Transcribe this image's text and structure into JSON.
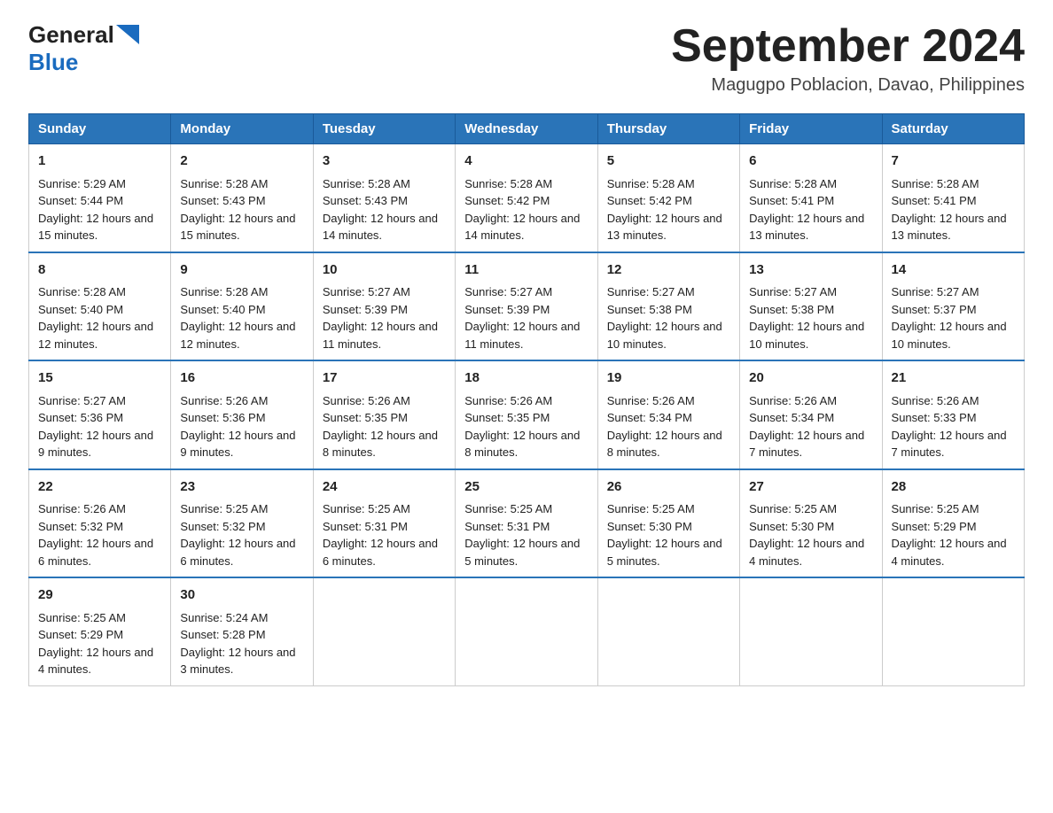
{
  "header": {
    "logo_general": "General",
    "logo_blue": "Blue",
    "title": "September 2024",
    "subtitle": "Magugpo Poblacion, Davao, Philippines"
  },
  "weekdays": [
    "Sunday",
    "Monday",
    "Tuesday",
    "Wednesday",
    "Thursday",
    "Friday",
    "Saturday"
  ],
  "weeks": [
    [
      {
        "day": "1",
        "sunrise": "5:29 AM",
        "sunset": "5:44 PM",
        "daylight": "12 hours and 15 minutes."
      },
      {
        "day": "2",
        "sunrise": "5:28 AM",
        "sunset": "5:43 PM",
        "daylight": "12 hours and 15 minutes."
      },
      {
        "day": "3",
        "sunrise": "5:28 AM",
        "sunset": "5:43 PM",
        "daylight": "12 hours and 14 minutes."
      },
      {
        "day": "4",
        "sunrise": "5:28 AM",
        "sunset": "5:42 PM",
        "daylight": "12 hours and 14 minutes."
      },
      {
        "day": "5",
        "sunrise": "5:28 AM",
        "sunset": "5:42 PM",
        "daylight": "12 hours and 13 minutes."
      },
      {
        "day": "6",
        "sunrise": "5:28 AM",
        "sunset": "5:41 PM",
        "daylight": "12 hours and 13 minutes."
      },
      {
        "day": "7",
        "sunrise": "5:28 AM",
        "sunset": "5:41 PM",
        "daylight": "12 hours and 13 minutes."
      }
    ],
    [
      {
        "day": "8",
        "sunrise": "5:28 AM",
        "sunset": "5:40 PM",
        "daylight": "12 hours and 12 minutes."
      },
      {
        "day": "9",
        "sunrise": "5:28 AM",
        "sunset": "5:40 PM",
        "daylight": "12 hours and 12 minutes."
      },
      {
        "day": "10",
        "sunrise": "5:27 AM",
        "sunset": "5:39 PM",
        "daylight": "12 hours and 11 minutes."
      },
      {
        "day": "11",
        "sunrise": "5:27 AM",
        "sunset": "5:39 PM",
        "daylight": "12 hours and 11 minutes."
      },
      {
        "day": "12",
        "sunrise": "5:27 AM",
        "sunset": "5:38 PM",
        "daylight": "12 hours and 10 minutes."
      },
      {
        "day": "13",
        "sunrise": "5:27 AM",
        "sunset": "5:38 PM",
        "daylight": "12 hours and 10 minutes."
      },
      {
        "day": "14",
        "sunrise": "5:27 AM",
        "sunset": "5:37 PM",
        "daylight": "12 hours and 10 minutes."
      }
    ],
    [
      {
        "day": "15",
        "sunrise": "5:27 AM",
        "sunset": "5:36 PM",
        "daylight": "12 hours and 9 minutes."
      },
      {
        "day": "16",
        "sunrise": "5:26 AM",
        "sunset": "5:36 PM",
        "daylight": "12 hours and 9 minutes."
      },
      {
        "day": "17",
        "sunrise": "5:26 AM",
        "sunset": "5:35 PM",
        "daylight": "12 hours and 8 minutes."
      },
      {
        "day": "18",
        "sunrise": "5:26 AM",
        "sunset": "5:35 PM",
        "daylight": "12 hours and 8 minutes."
      },
      {
        "day": "19",
        "sunrise": "5:26 AM",
        "sunset": "5:34 PM",
        "daylight": "12 hours and 8 minutes."
      },
      {
        "day": "20",
        "sunrise": "5:26 AM",
        "sunset": "5:34 PM",
        "daylight": "12 hours and 7 minutes."
      },
      {
        "day": "21",
        "sunrise": "5:26 AM",
        "sunset": "5:33 PM",
        "daylight": "12 hours and 7 minutes."
      }
    ],
    [
      {
        "day": "22",
        "sunrise": "5:26 AM",
        "sunset": "5:32 PM",
        "daylight": "12 hours and 6 minutes."
      },
      {
        "day": "23",
        "sunrise": "5:25 AM",
        "sunset": "5:32 PM",
        "daylight": "12 hours and 6 minutes."
      },
      {
        "day": "24",
        "sunrise": "5:25 AM",
        "sunset": "5:31 PM",
        "daylight": "12 hours and 6 minutes."
      },
      {
        "day": "25",
        "sunrise": "5:25 AM",
        "sunset": "5:31 PM",
        "daylight": "12 hours and 5 minutes."
      },
      {
        "day": "26",
        "sunrise": "5:25 AM",
        "sunset": "5:30 PM",
        "daylight": "12 hours and 5 minutes."
      },
      {
        "day": "27",
        "sunrise": "5:25 AM",
        "sunset": "5:30 PM",
        "daylight": "12 hours and 4 minutes."
      },
      {
        "day": "28",
        "sunrise": "5:25 AM",
        "sunset": "5:29 PM",
        "daylight": "12 hours and 4 minutes."
      }
    ],
    [
      {
        "day": "29",
        "sunrise": "5:25 AM",
        "sunset": "5:29 PM",
        "daylight": "12 hours and 4 minutes."
      },
      {
        "day": "30",
        "sunrise": "5:24 AM",
        "sunset": "5:28 PM",
        "daylight": "12 hours and 3 minutes."
      },
      null,
      null,
      null,
      null,
      null
    ]
  ],
  "labels": {
    "sunrise_prefix": "Sunrise: ",
    "sunset_prefix": "Sunset: ",
    "daylight_prefix": "Daylight: "
  }
}
